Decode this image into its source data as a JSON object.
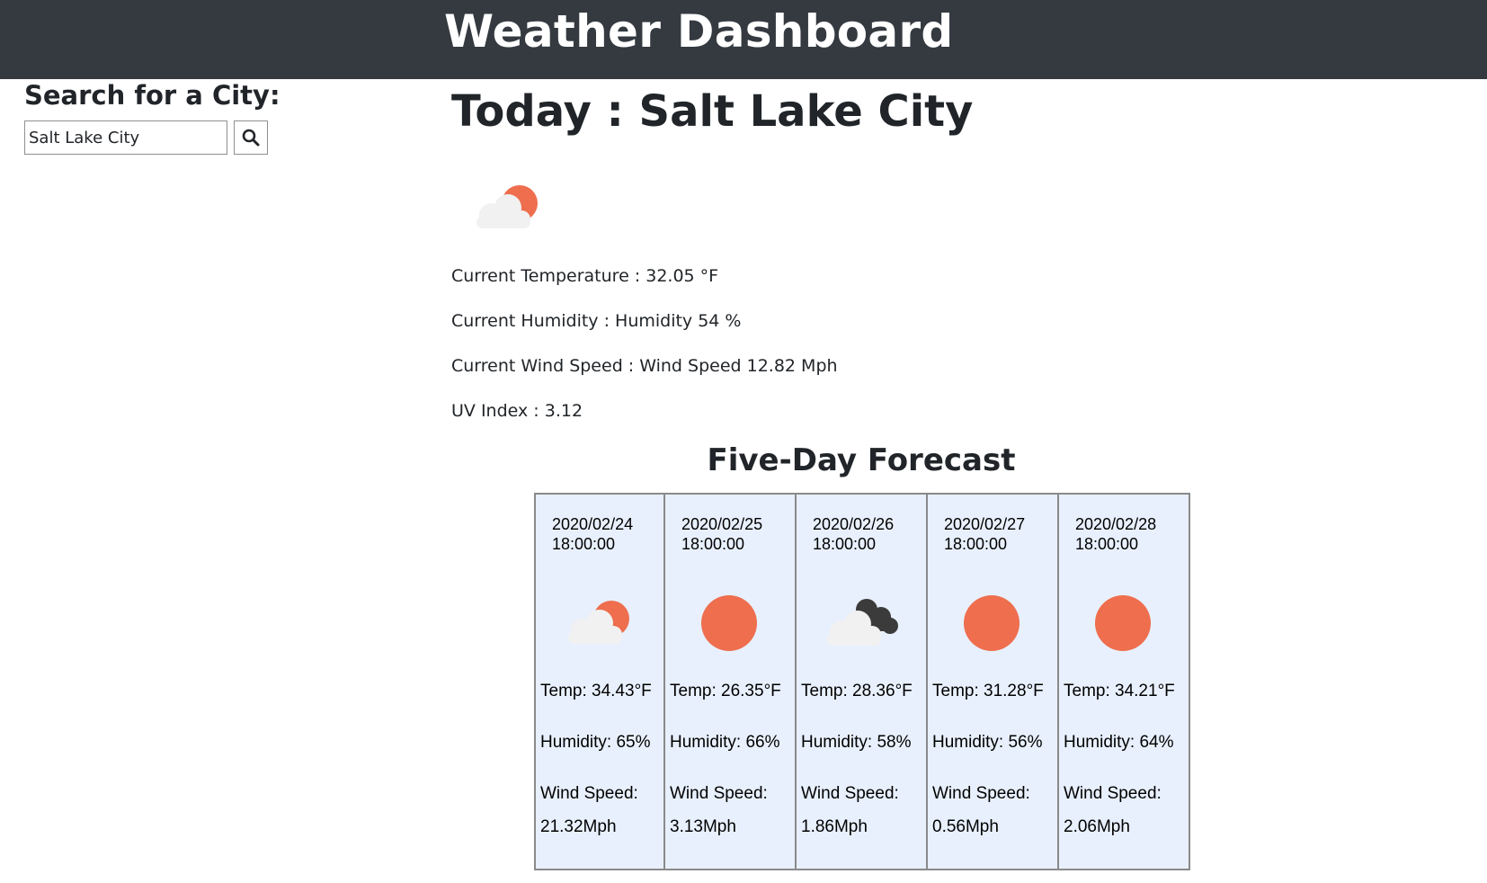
{
  "header": {
    "title": "Weather Dashboard"
  },
  "search": {
    "label": "Search for a City:",
    "value": "Salt Lake City",
    "button_icon": "search-icon"
  },
  "today": {
    "title": "Today : Salt Lake City",
    "icon": "sun-behind-cloud-icon",
    "temperature": "Current Temperature : 32.05 °F",
    "humidity": "Current Humidity : Humidity 54 %",
    "wind": "Current Wind Speed : Wind Speed 12.82 Mph",
    "uv": "UV Index : 3.12"
  },
  "forecast": {
    "title": "Five-Day Forecast",
    "days": [
      {
        "date": "2020/02/24",
        "time": "18:00:00",
        "icon": "sun-behind-cloud-icon",
        "temp": "Temp: 34.43°F",
        "humidity": "Humidity: 65%",
        "wind_label": "Wind Speed:",
        "wind": "21.32Mph"
      },
      {
        "date": "2020/02/25",
        "time": "18:00:00",
        "icon": "sun-icon",
        "temp": "Temp: 26.35°F",
        "humidity": "Humidity: 66%",
        "wind_label": "Wind Speed:",
        "wind": "3.13Mph"
      },
      {
        "date": "2020/02/26",
        "time": "18:00:00",
        "icon": "dark-clouds-icon",
        "temp": "Temp: 28.36°F",
        "humidity": "Humidity: 58%",
        "wind_label": "Wind Speed:",
        "wind": "1.86Mph"
      },
      {
        "date": "2020/02/27",
        "time": "18:00:00",
        "icon": "sun-icon",
        "temp": "Temp: 31.28°F",
        "humidity": "Humidity: 56%",
        "wind_label": "Wind Speed:",
        "wind": "0.56Mph"
      },
      {
        "date": "2020/02/28",
        "time": "18:00:00",
        "icon": "sun-icon",
        "temp": "Temp: 34.21°F",
        "humidity": "Humidity: 64%",
        "wind_label": "Wind Speed:",
        "wind": "2.06Mph"
      }
    ]
  },
  "colors": {
    "header_bg": "#343a40",
    "sun": "#ee6e4e",
    "cloud_light": "#f1f1f1",
    "cloud_dark": "#3b3b3b",
    "card_bg": "#e8f0fd"
  }
}
